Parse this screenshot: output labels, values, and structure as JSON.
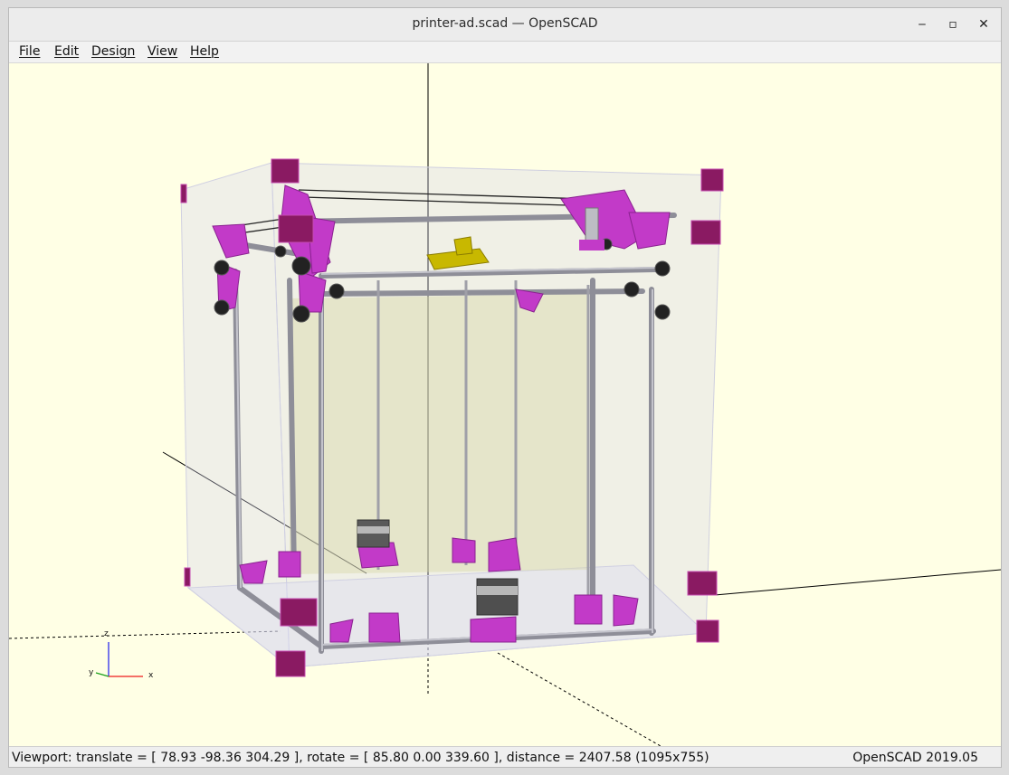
{
  "window": {
    "title": "printer-ad.scad — OpenSCAD",
    "controls": {
      "minimize": "‒",
      "maximize": "▫",
      "close": "✕"
    }
  },
  "menu": [
    "File",
    "Edit",
    "Design",
    "View",
    "Help"
  ],
  "viewport": {
    "background": "#ffffe5",
    "part_color": "#c23ac8",
    "corner_color": "#8a1a62",
    "enclosure_color": "#c9c9e8",
    "axis_labels": {
      "x": "x",
      "y": "y",
      "z": "z"
    }
  },
  "status": {
    "viewport_info": "Viewport: translate = [ 78.93 -98.36 304.29 ], rotate = [ 85.80 0.00 339.60 ], distance = 2407.58 (1095x755)",
    "version": "OpenSCAD 2019.05"
  }
}
